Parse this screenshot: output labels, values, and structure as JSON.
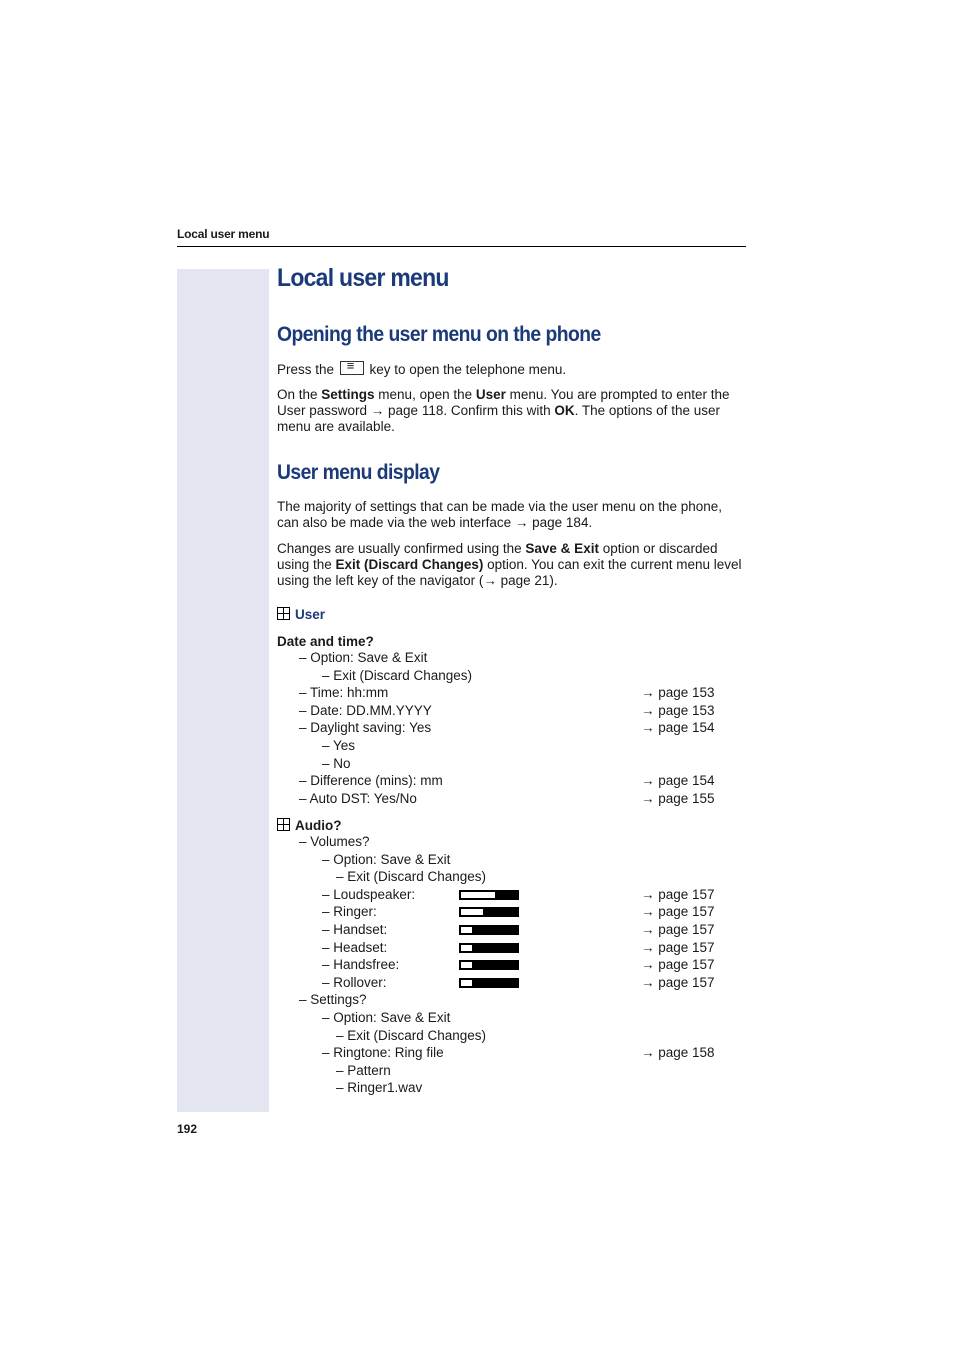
{
  "running_head": "Local user menu",
  "page_number": "192",
  "title": "Local user menu",
  "section1": {
    "heading": "Opening the user menu on the phone",
    "p1_before": "Press the ",
    "p1_key_icon": "menu-key-icon",
    "p1_after": " key to open the telephone menu.",
    "p2": [
      {
        "t": "On the ",
        "b": false
      },
      {
        "t": "Settings",
        "b": true
      },
      {
        "t": " menu, open the ",
        "b": false
      },
      {
        "t": "User",
        "b": true
      },
      {
        "t": " menu. You are prompted to enter the User password → page 118. Confirm this with ",
        "b": false
      },
      {
        "t": "OK",
        "b": true
      },
      {
        "t": ". The options of the user menu are available.",
        "b": false
      }
    ]
  },
  "section2": {
    "heading": "User menu display",
    "p1": "The majority of settings that can be made via the user menu on the phone, can also be made via the web interface → page 184.",
    "p2": [
      {
        "t": "Changes are usually confirmed using the ",
        "b": false
      },
      {
        "t": "Save & Exit",
        "b": true
      },
      {
        "t": " option or discarded using the ",
        "b": false
      },
      {
        "t": "Exit (Discard Changes)",
        "b": true
      },
      {
        "t": " option. You can exit the current menu level using the left key of the navigator (→ page 21).",
        "b": false
      }
    ]
  },
  "user_header": "User",
  "date_time": {
    "heading": "Date and time?",
    "rows": [
      {
        "level": 1,
        "text": "– Option: Save & Exit",
        "ref": ""
      },
      {
        "level": 2,
        "text": "– Exit (Discard Changes)",
        "ref": ""
      },
      {
        "level": 1,
        "text": "– Time: hh:mm",
        "ref": "→ page 153"
      },
      {
        "level": 1,
        "text": "– Date: DD.MM.YYYY",
        "ref": "→ page 153"
      },
      {
        "level": 1,
        "text": "– Daylight saving: Yes",
        "ref": "→ page 154"
      },
      {
        "level": 2,
        "text": "– Yes",
        "ref": ""
      },
      {
        "level": 2,
        "text": "– No",
        "ref": ""
      },
      {
        "level": 1,
        "text": "– Difference (mins): mm",
        "ref": "→ page 154"
      },
      {
        "level": 1,
        "text": "– Auto DST: Yes/No",
        "ref": "→ page 155"
      }
    ]
  },
  "audio": {
    "heading": "Audio?",
    "rows": [
      {
        "level": 1,
        "text": "– Volumes?",
        "ref": ""
      },
      {
        "level": 2,
        "text": "– Option: Save & Exit",
        "ref": ""
      },
      {
        "level": 3,
        "text": "– Exit (Discard Changes)",
        "ref": ""
      },
      {
        "level": 2,
        "text": "– Loudspeaker:",
        "ref": "→ page 157",
        "volume": 0.6
      },
      {
        "level": 2,
        "text": "– Ringer:",
        "ref": "→ page 157",
        "volume": 0.4
      },
      {
        "level": 2,
        "text": "– Handset:",
        "ref": "→ page 157",
        "volume": 0.2
      },
      {
        "level": 2,
        "text": "– Headset:",
        "ref": "→ page 157",
        "volume": 0.2
      },
      {
        "level": 2,
        "text": "– Handsfree:",
        "ref": "→ page 157",
        "volume": 0.2
      },
      {
        "level": 2,
        "text": "– Rollover:",
        "ref": "→ page 157",
        "volume": 0.2
      },
      {
        "level": 1,
        "text": "– Settings?",
        "ref": ""
      },
      {
        "level": 2,
        "text": "– Option: Save & Exit",
        "ref": ""
      },
      {
        "level": 3,
        "text": "– Exit (Discard Changes)",
        "ref": ""
      },
      {
        "level": 2,
        "text": "– Ringtone: Ring file",
        "ref": "→ page 158"
      },
      {
        "level": 3,
        "text": "– Pattern",
        "ref": ""
      },
      {
        "level": 3,
        "text": "– Ringer1.wav",
        "ref": ""
      }
    ]
  }
}
